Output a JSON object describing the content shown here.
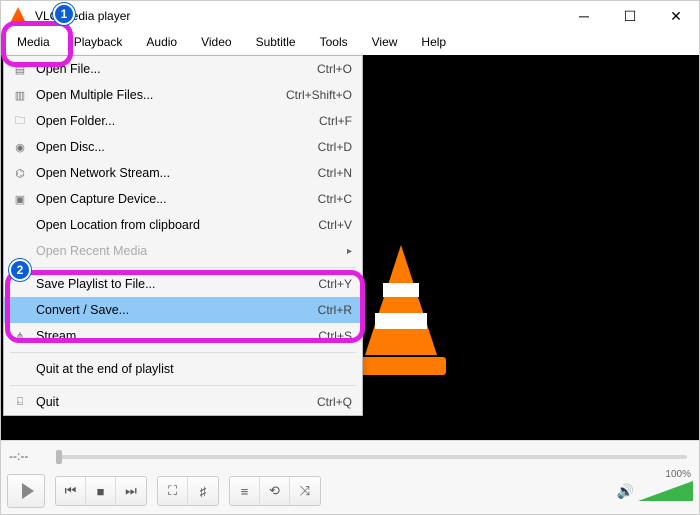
{
  "window": {
    "title": "VLC media player"
  },
  "menubar": [
    "Media",
    "Playback",
    "Audio",
    "Video",
    "Subtitle",
    "Tools",
    "View",
    "Help"
  ],
  "dropdown": {
    "sections": [
      [
        {
          "icon": "file-icon",
          "label": "Open File...",
          "shortcut": "Ctrl+O"
        },
        {
          "icon": "files-icon",
          "label": "Open Multiple Files...",
          "shortcut": "Ctrl+Shift+O"
        },
        {
          "icon": "folder-icon",
          "label": "Open Folder...",
          "shortcut": "Ctrl+F"
        },
        {
          "icon": "disc-icon",
          "label": "Open Disc...",
          "shortcut": "Ctrl+D"
        },
        {
          "icon": "network-icon",
          "label": "Open Network Stream...",
          "shortcut": "Ctrl+N"
        },
        {
          "icon": "capture-icon",
          "label": "Open Capture Device...",
          "shortcut": "Ctrl+C"
        },
        {
          "icon": "",
          "label": "Open Location from clipboard",
          "shortcut": "Ctrl+V"
        },
        {
          "icon": "",
          "label": "Open Recent Media",
          "shortcut": "",
          "disabled": true,
          "submenu": true
        }
      ],
      [
        {
          "icon": "",
          "label": "Save Playlist to File...",
          "shortcut": "Ctrl+Y"
        },
        {
          "icon": "",
          "label": "Convert / Save...",
          "shortcut": "Ctrl+R",
          "selected": true
        },
        {
          "icon": "stream-icon",
          "label": "Stream...",
          "shortcut": "Ctrl+S"
        }
      ],
      [
        {
          "icon": "",
          "label": "Quit at the end of playlist",
          "shortcut": ""
        }
      ],
      [
        {
          "icon": "quit-icon",
          "label": "Quit",
          "shortcut": "Ctrl+Q"
        }
      ]
    ]
  },
  "controls": {
    "time": "--:--",
    "volume_pct": "100%"
  },
  "annotations": {
    "c1": "1",
    "c2": "2"
  }
}
